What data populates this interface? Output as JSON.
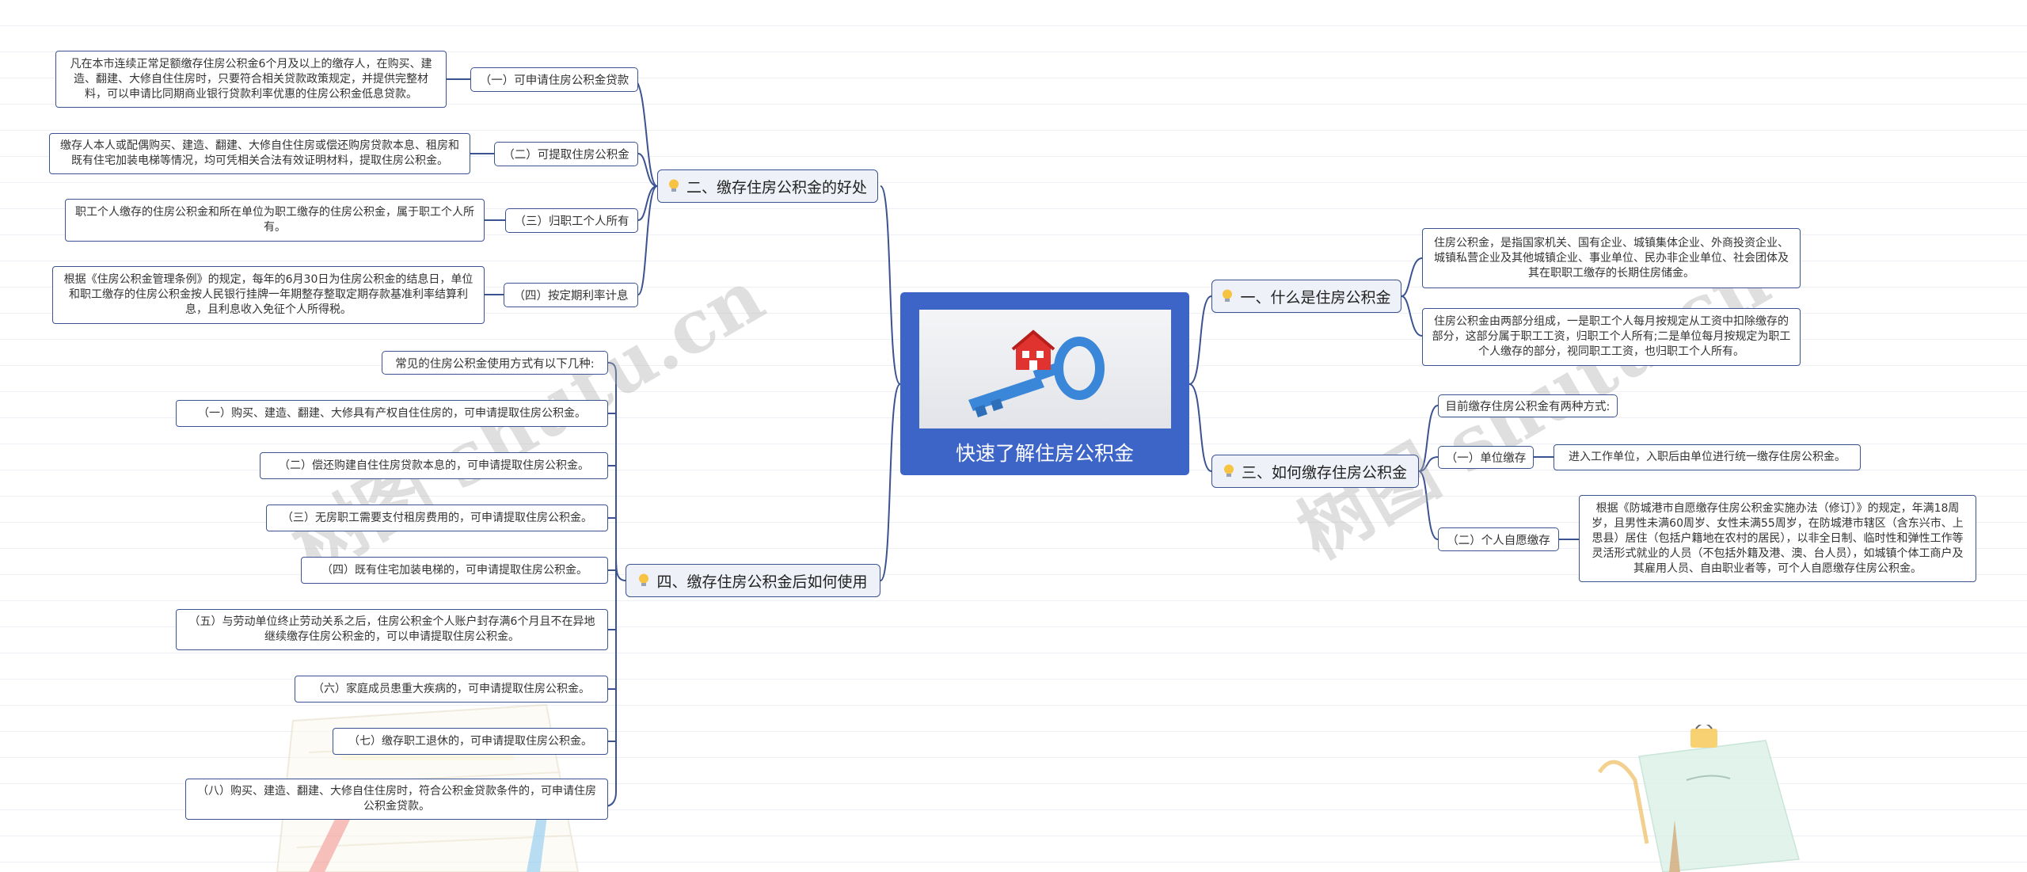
{
  "root": {
    "title": "快速了解住房公积金",
    "image_icon": "house-key-icon"
  },
  "branches": {
    "b1": {
      "label": "一、什么是住房公积金",
      "leaves": [
        "住房公积金，是指国家机关、国有企业、城镇集体企业、外商投资企业、城镇私营企业及其他城镇企业、事业单位、民办非企业单位、社会团体及其在职职工缴存的长期住房储金。",
        "住房公积金由两部分组成，一是职工个人每月按规定从工资中扣除缴存的部分，这部分属于职工工资，归职工个人所有;二是单位每月按规定为职工个人缴存的部分，视同职工工资，也归职工个人所有。"
      ]
    },
    "b2": {
      "label": "二、缴存住房公积金的好处",
      "subs": [
        {
          "label": "（一）可申请住房公积金贷款",
          "leaf": "凡在本市连续正常足额缴存住房公积金6个月及以上的缴存人，在购买、建造、翻建、大修自住住房时，只要符合相关贷款政策规定，并提供完整材料，可以申请比同期商业银行贷款利率优惠的住房公积金低息贷款。"
        },
        {
          "label": "（二）可提取住房公积金",
          "leaf": "缴存人本人或配偶购买、建造、翻建、大修自住住房或偿还购房贷款本息、租房和既有住宅加装电梯等情况，均可凭相关合法有效证明材料，提取住房公积金。"
        },
        {
          "label": "（三）归职工个人所有",
          "leaf": "职工个人缴存的住房公积金和所在单位为职工缴存的住房公积金，属于职工个人所有。"
        },
        {
          "label": "（四）按定期利率计息",
          "leaf": "根据《住房公积金管理条例》的规定，每年的6月30日为住房公积金的结息日，单位和职工缴存的住房公积金按人民银行挂牌一年期整存整取定期存款基准利率结算利息，且利息收入免征个人所得税。"
        }
      ]
    },
    "b3": {
      "label": "三、如何缴存住房公积金",
      "intro": "目前缴存住房公积金有两种方式:",
      "subs": [
        {
          "label": "（一）单位缴存",
          "leaf": "进入工作单位，入职后由单位进行统一缴存住房公积金。"
        },
        {
          "label": "（二）个人自愿缴存",
          "leaf": "根据《防城港市自愿缴存住房公积金实施办法（修订）》的规定，年满18周岁，且男性未满60周岁、女性未满55周岁，在防城港市辖区（含东兴市、上思县）居住（包括户籍地在农村的居民），以非全日制、临时性和弹性工作等灵活形式就业的人员（不包括外籍及港、澳、台人员），如城镇个体工商户及其雇用人员、自由职业者等，可个人自愿缴存住房公积金。"
        }
      ]
    },
    "b4": {
      "label": "四、缴存住房公积金后如何使用",
      "items": [
        "常见的住房公积金使用方式有以下几种:",
        "（一）购买、建造、翻建、大修具有产权自住住房的，可申请提取住房公积金。",
        "（二）偿还购建自住住房贷款本息的，可申请提取住房公积金。",
        "（三）无房职工需要支付租房费用的，可申请提取住房公积金。",
        "（四）既有住宅加装电梯的，可申请提取住房公积金。",
        "（五）与劳动单位终止劳动关系之后，住房公积金个人账户封存满6个月且不在异地继续缴存住房公积金的，可以申请提取住房公积金。",
        "（六）家庭成员患重大疾病的，可申请提取住房公积金。",
        "（七）缴存职工退休的，可申请提取住房公积金。",
        "（八）购买、建造、翻建、大修自住住房时，符合公积金贷款条件的，可申请住房公积金贷款。"
      ]
    }
  },
  "branch_icon": "lightbulb-icon",
  "watermarks": [
    "树图 shutu.cn",
    "树图 shutu.cn"
  ],
  "decor_icons": [
    "notepad-icon",
    "memo-pin-icon"
  ],
  "colors": {
    "root": "#3d64c7",
    "line": "#3b5390",
    "branch_bg": "#eef1f7",
    "bulb": "#f6c343"
  }
}
